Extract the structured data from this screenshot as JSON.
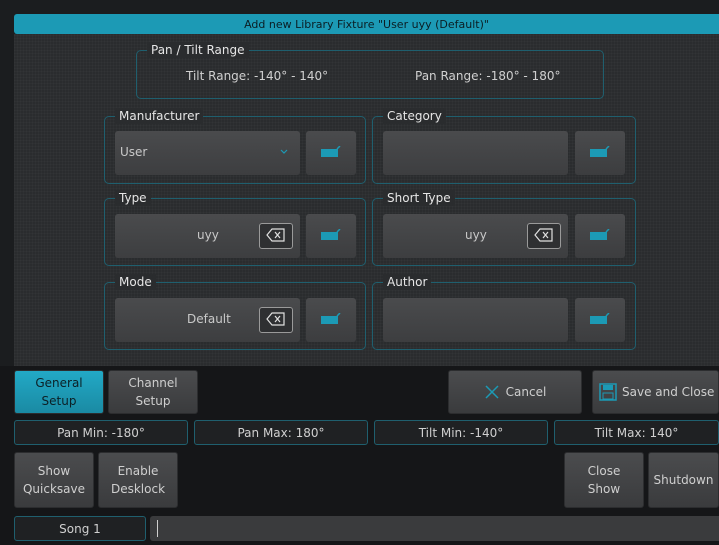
{
  "dialog": {
    "title": "Add new Library Fixture \"User uyy (Default)\""
  },
  "pan_tilt": {
    "legend": "Pan / Tilt Range",
    "tilt_range": "Tilt Range: -140° - 140°",
    "pan_range": "Pan Range: -180° - 180°"
  },
  "manufacturer": {
    "legend": "Manufacturer",
    "value": "User",
    "icon": "chevron-down-icon"
  },
  "category": {
    "legend": "Category",
    "value": ""
  },
  "type": {
    "legend": "Type",
    "value": "uyy"
  },
  "short_type": {
    "legend": "Short Type",
    "value": "uyy"
  },
  "mode": {
    "legend": "Mode",
    "value": "Default"
  },
  "author": {
    "legend": "Author",
    "value": ""
  },
  "tabs": {
    "general_line1": "General",
    "general_line2": "Setup",
    "channel_line1": "Channel",
    "channel_line2": "Setup"
  },
  "actions": {
    "cancel": "Cancel",
    "save_close": "Save and Close"
  },
  "status": {
    "pan_min": "Pan Min: -180°",
    "pan_max": "Pan Max: 180°",
    "tilt_min": "Tilt Min: -140°",
    "tilt_max": "Tilt Max: 140°"
  },
  "bottom": {
    "show_quicksave_1": "Show",
    "show_quicksave_2": "Quicksave",
    "enable_desklock_1": "Enable",
    "enable_desklock_2": "Desklock",
    "close_show_1": "Close",
    "close_show_2": "Show",
    "shutdown": "Shutdown",
    "song": "Song 1"
  },
  "colors": {
    "accent": "#1c9ab5",
    "border": "#1f5f6e",
    "background": "#2a2c2e"
  }
}
